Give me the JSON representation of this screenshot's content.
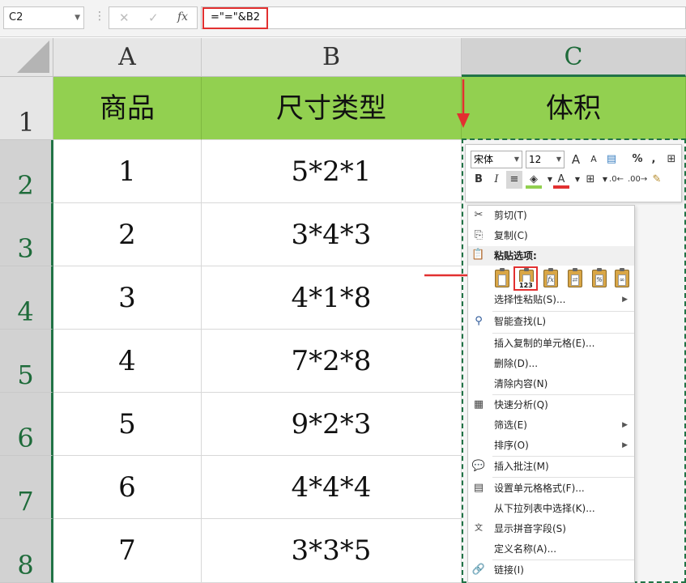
{
  "formula_bar": {
    "name_box": "C2",
    "separator": "⋮",
    "cancel_icon": "✕",
    "enter_icon": "✓",
    "fx_label": "fx",
    "formula": "=\"=\"&B2"
  },
  "columns": [
    "A",
    "B",
    "C"
  ],
  "rows": [
    "1",
    "2",
    "3",
    "4",
    "5",
    "6",
    "7",
    "8"
  ],
  "header_row": {
    "a": "商品",
    "b": "尺寸类型",
    "c": "体积"
  },
  "data_rows": [
    {
      "a": "1",
      "b": "5*2*1"
    },
    {
      "a": "2",
      "b": "3*4*3"
    },
    {
      "a": "3",
      "b": "4*1*8"
    },
    {
      "a": "4",
      "b": "7*2*8"
    },
    {
      "a": "5",
      "b": "9*2*3"
    },
    {
      "a": "6",
      "b": "4*4*4"
    },
    {
      "a": "7",
      "b": "3*3*5"
    }
  ],
  "mini_toolbar": {
    "font_name": "宋体",
    "font_size": "12",
    "grow_font": "A",
    "shrink_font": "A",
    "percent": "%",
    "comma": ",",
    "bold": "B",
    "italic": "I",
    "font_color_letter": "A",
    "font_color": "#e23030",
    "fill_color": "#92d050"
  },
  "context_menu": {
    "cut": "剪切(T)",
    "copy": "复制(C)",
    "paste_options": "粘贴选项:",
    "paste_values_badge": "123",
    "paste_formula_glyph": "fx",
    "paste_percent_glyph": "%",
    "paste_special": "选择性粘贴(S)...",
    "smart_lookup": "智能查找(L)",
    "insert_copied": "插入复制的单元格(E)...",
    "delete": "删除(D)...",
    "clear_contents": "清除内容(N)",
    "quick_analysis": "快速分析(Q)",
    "filter": "筛选(E)",
    "sort": "排序(O)",
    "insert_comment": "插入批注(M)",
    "format_cells": "设置单元格格式(F)...",
    "pick_from_list": "从下拉列表中选择(K)...",
    "phonetic": "显示拼音字段(S)",
    "define_name": "定义名称(A)...",
    "link": "链接(I)"
  },
  "accent_colors": {
    "header_green": "#92d050",
    "selection_green": "#217346",
    "annotation_red": "#e23030"
  }
}
